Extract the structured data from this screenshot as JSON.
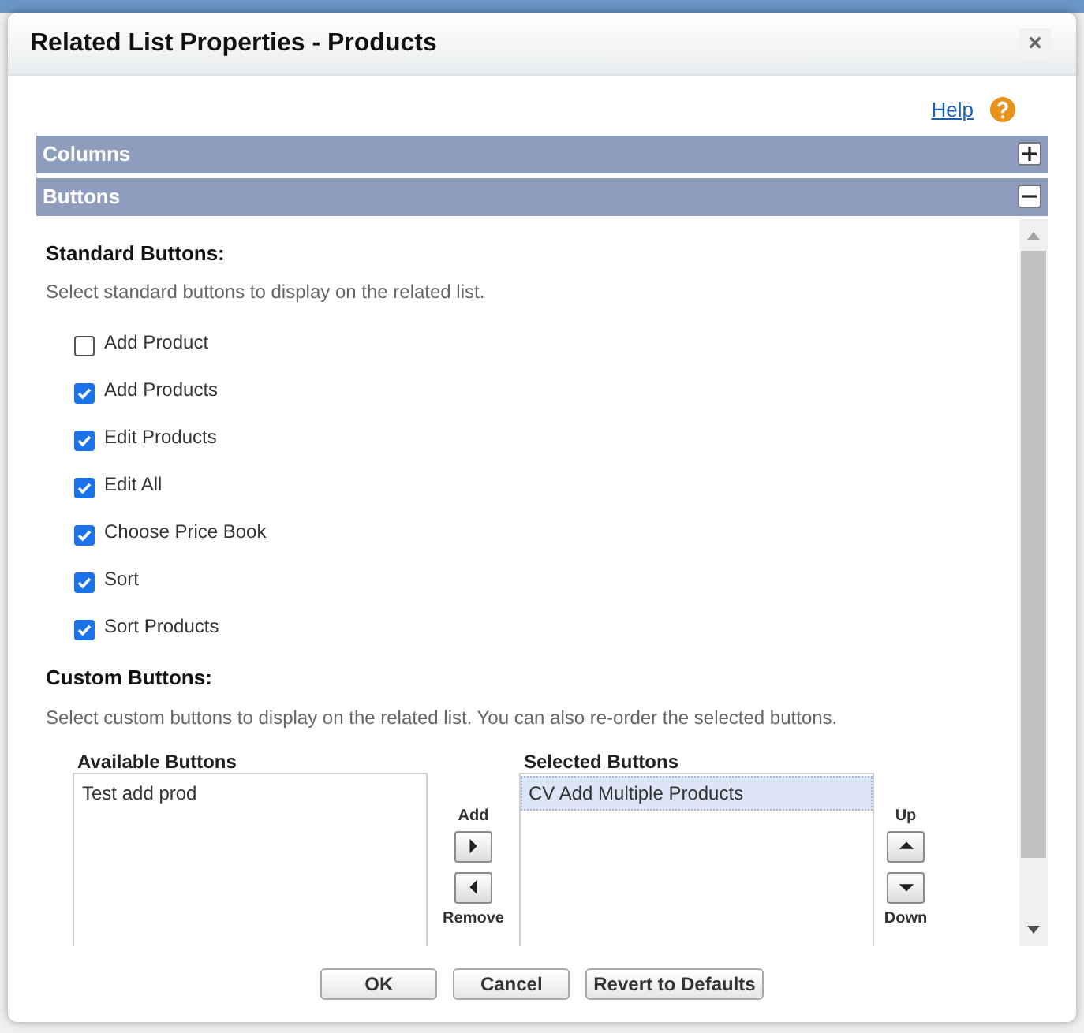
{
  "dialog": {
    "title": "Related List Properties - Products",
    "close": "×",
    "help": "Help"
  },
  "sections": [
    {
      "title": "Columns",
      "expanded": false
    },
    {
      "title": "Buttons",
      "expanded": true
    }
  ],
  "standard_buttons": {
    "heading": "Standard Buttons:",
    "description": "Select standard buttons to display on the related list.",
    "items": [
      {
        "label": "Add Product",
        "checked": false
      },
      {
        "label": "Add Products",
        "checked": true
      },
      {
        "label": "Edit Products",
        "checked": true
      },
      {
        "label": "Edit All",
        "checked": true
      },
      {
        "label": "Choose Price Book",
        "checked": true
      },
      {
        "label": "Sort",
        "checked": true
      },
      {
        "label": "Sort Products",
        "checked": true
      }
    ]
  },
  "custom_buttons": {
    "heading": "Custom Buttons:",
    "description": "Select custom buttons to display on the related list. You can also re-order the selected buttons.",
    "available": {
      "title": "Available Buttons",
      "items": [
        {
          "label": "Test add prod",
          "selected": false
        }
      ]
    },
    "add_label": "Add",
    "remove_label": "Remove",
    "selected": {
      "title": "Selected Buttons",
      "items": [
        {
          "label": "CV Add Multiple Products",
          "selected": true
        }
      ]
    },
    "up_label": "Up",
    "down_label": "Down"
  },
  "footer_buttons": [
    "OK",
    "Cancel",
    "Revert to Defaults"
  ]
}
